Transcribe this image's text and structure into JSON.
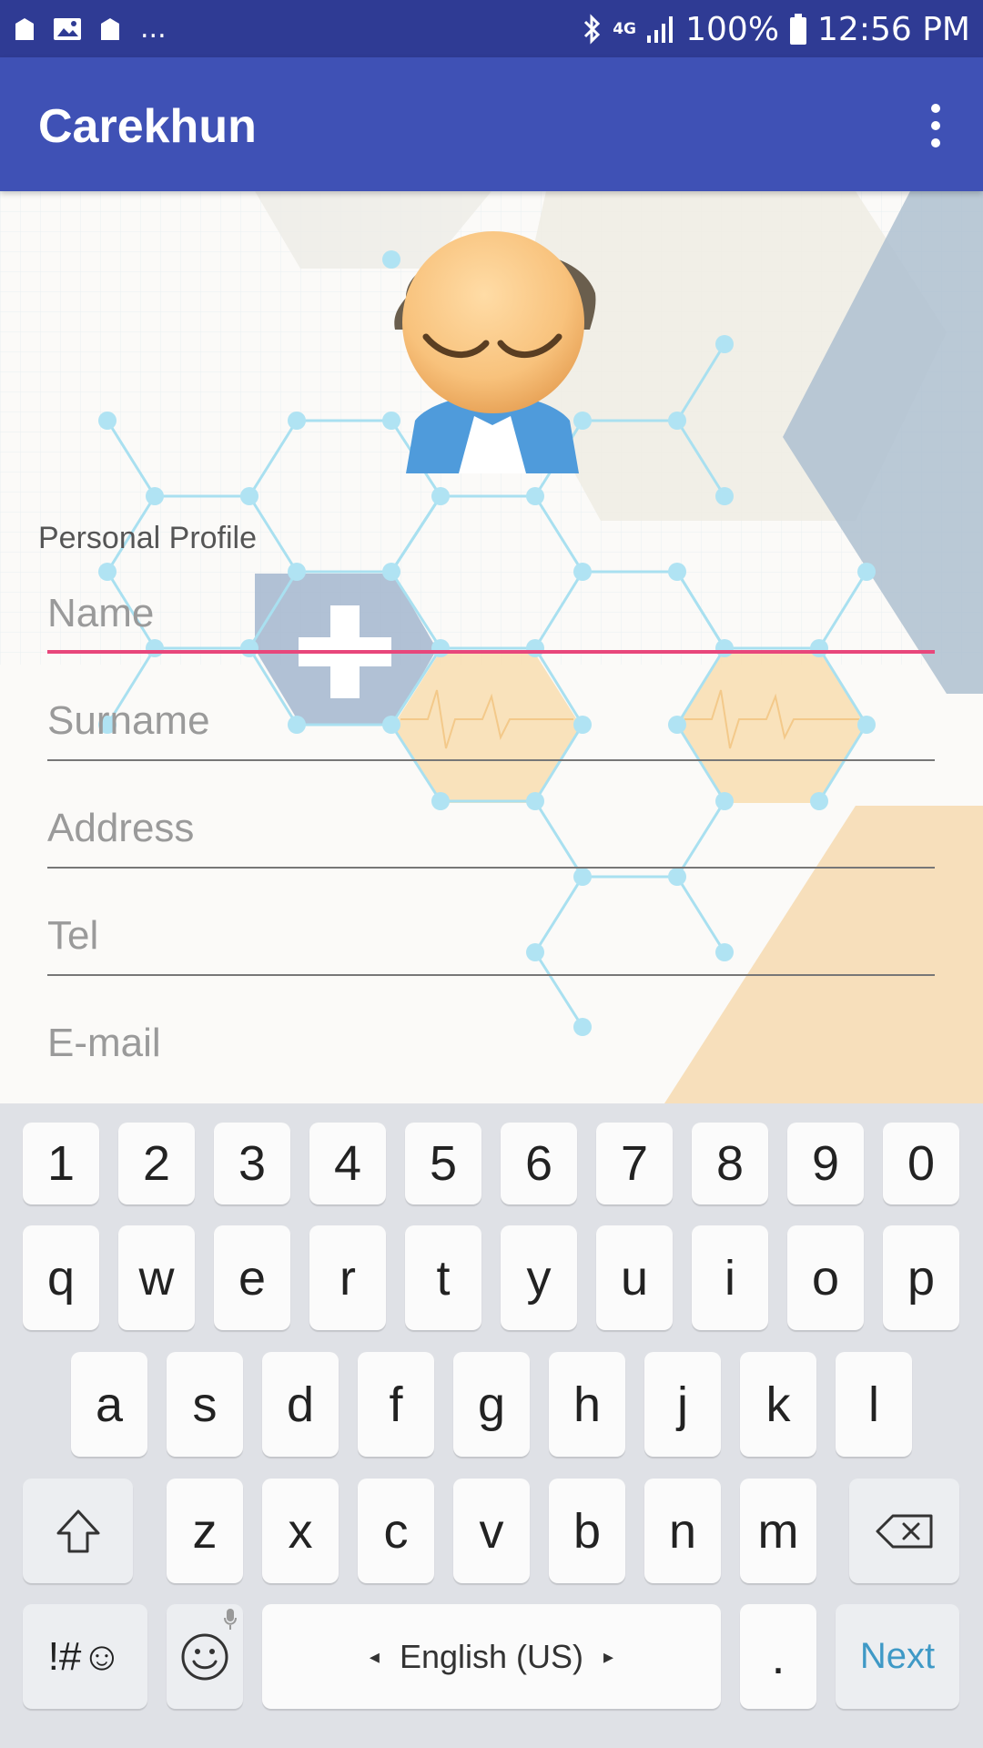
{
  "status_bar": {
    "overflow_indicator": "...",
    "network": "4G",
    "battery": "100%",
    "time": "12:56 PM"
  },
  "app_bar": {
    "title": "Carekhun"
  },
  "form": {
    "section_label": "Personal Profile",
    "fields": {
      "name": {
        "value": "",
        "placeholder": "Name"
      },
      "surname": {
        "value": "",
        "placeholder": "Surname"
      },
      "address": {
        "value": "",
        "placeholder": "Address"
      },
      "tel": {
        "value": "",
        "placeholder": "Tel"
      },
      "email": {
        "value": "",
        "placeholder": "E-mail"
      }
    },
    "focused_field": "name"
  },
  "keyboard": {
    "row_numbers": [
      "1",
      "2",
      "3",
      "4",
      "5",
      "6",
      "7",
      "8",
      "9",
      "0"
    ],
    "row_top": [
      "q",
      "w",
      "e",
      "r",
      "t",
      "y",
      "u",
      "i",
      "o",
      "p"
    ],
    "row_middle": [
      "a",
      "s",
      "d",
      "f",
      "g",
      "h",
      "j",
      "k",
      "l"
    ],
    "row_bottom": [
      "z",
      "x",
      "c",
      "v",
      "b",
      "n",
      "m"
    ],
    "symbols_label": "!#☺",
    "language_label": "English (US)",
    "period_label": ".",
    "next_label": "Next"
  },
  "colors": {
    "status_bar": "#2f3b94",
    "app_bar": "#3f51b5",
    "focus_underline": "#e8477b",
    "next_key_text": "#3f99c6",
    "keyboard_bg": "#dfe1e6"
  },
  "icons": [
    "bag-icon",
    "image-icon",
    "bluetooth-icon",
    "signal-icon",
    "battery-icon",
    "more-vert-icon",
    "avatar-icon",
    "shift-icon",
    "backspace-icon",
    "emoji-icon",
    "mic-icon"
  ]
}
